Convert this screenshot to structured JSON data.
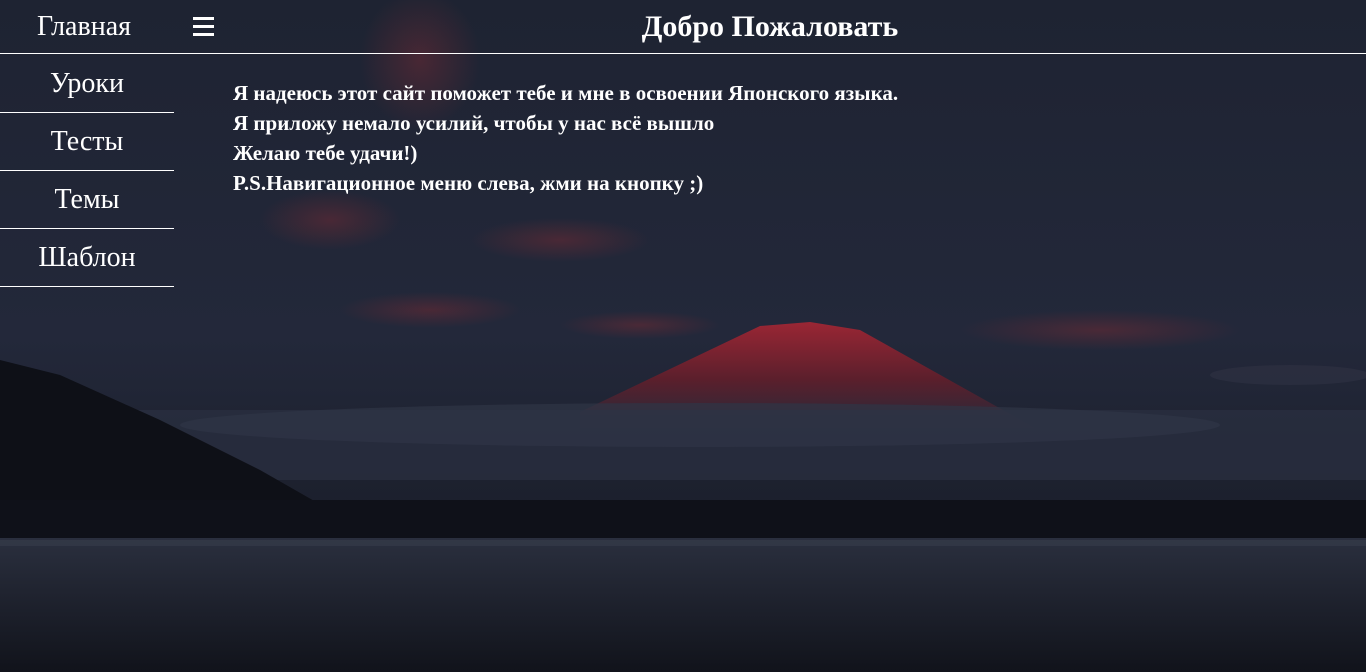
{
  "header": {
    "home_label": "Главная",
    "menu_icon": "hamburger-menu-icon",
    "title": "Добро Пожаловать"
  },
  "sidebar": {
    "items": [
      {
        "label": "Уроки"
      },
      {
        "label": "Тесты"
      },
      {
        "label": "Темы"
      },
      {
        "label": "Шаблон"
      }
    ]
  },
  "content": {
    "lines": [
      "Я надеюсь этот сайт поможет тебе и мне в освоении Японского языка.",
      "Я приложу немало усилий, чтобы у нас всё вышло",
      "Желаю тебе удачи!)",
      "P.S.Навигационное меню слева, жми на кнопку ;)"
    ]
  },
  "colors": {
    "text": "#ffffff",
    "sky_dark": "#1b2030",
    "mountain_red": "#8a2230",
    "water": "#151822"
  }
}
